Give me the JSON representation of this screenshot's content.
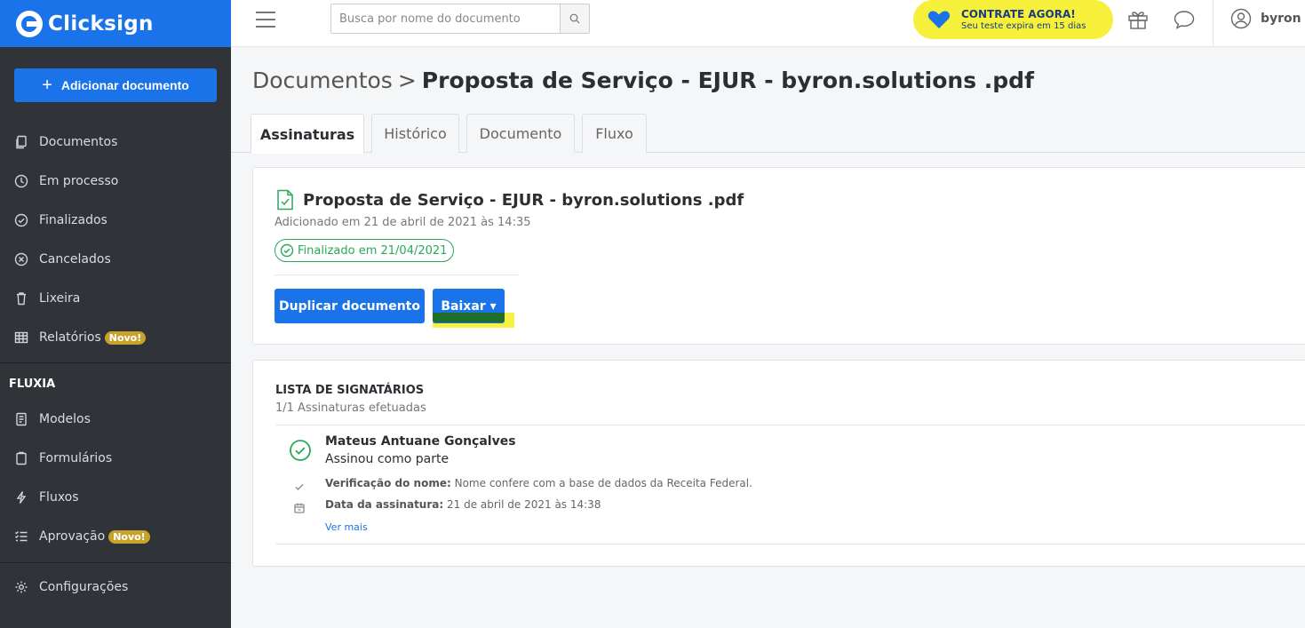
{
  "brand": {
    "name": "Clicksign",
    "primary_color": "#1a73e8",
    "sidebar_color": "#303338"
  },
  "sidebar": {
    "add_button_label": "Adicionar documento",
    "items": [
      {
        "label": "Documentos",
        "icon": "documents-icon"
      },
      {
        "label": "Em processo",
        "icon": "clock-icon"
      },
      {
        "label": "Finalizados",
        "icon": "check-circle-icon"
      },
      {
        "label": "Cancelados",
        "icon": "x-circle-icon"
      },
      {
        "label": "Lixeira",
        "icon": "trash-icon"
      },
      {
        "label": "Relatórios",
        "icon": "table-icon",
        "badge": "Novo!"
      }
    ],
    "section_title": "FLUXIA",
    "fluxia_items": [
      {
        "label": "Modelos",
        "icon": "template-icon"
      },
      {
        "label": "Formulários",
        "icon": "clipboard-icon"
      },
      {
        "label": "Fluxos",
        "icon": "bolt-icon"
      },
      {
        "label": "Aprovação",
        "icon": "checklist-icon",
        "badge": "Novo!"
      }
    ],
    "settings_label": "Configurações"
  },
  "topbar": {
    "search_placeholder": "Busca por nome do documento",
    "cta_title": "CONTRATE AGORA!",
    "cta_subtitle": "Seu teste expira em 15 dias",
    "cta_color": "#f7f03a",
    "user_name": "byron"
  },
  "breadcrumb": {
    "root": "Documentos",
    "separator": ">",
    "current": "Proposta de Serviço - EJUR - byron.solutions .pdf"
  },
  "tabs": [
    {
      "label": "Assinaturas",
      "active": true
    },
    {
      "label": "Histórico",
      "active": false
    },
    {
      "label": "Documento",
      "active": false
    },
    {
      "label": "Fluxo",
      "active": false
    }
  ],
  "document": {
    "title": "Proposta de Serviço - EJUR - byron.solutions .pdf",
    "added": "Adicionado em 21 de abril de 2021 às 14:35",
    "status": "Finalizado em 21/04/2021",
    "status_color": "#2aa85a",
    "duplicate_label": "Duplicar documento",
    "download_label": "Baixar ▾"
  },
  "signers": {
    "title": "LISTA DE SIGNATÁRIOS",
    "count": "1/1 Assinaturas efetuadas",
    "items": [
      {
        "name": "Mateus Antuane Gonçalves",
        "role": "Assinou como parte",
        "verification_label": "Verificação do nome:",
        "verification_value": "Nome confere com a base de dados da Receita Federal.",
        "date_label": "Data da assinatura:",
        "date_value": "21 de abril de 2021 às 14:38",
        "see_more": "Ver mais"
      }
    ]
  }
}
